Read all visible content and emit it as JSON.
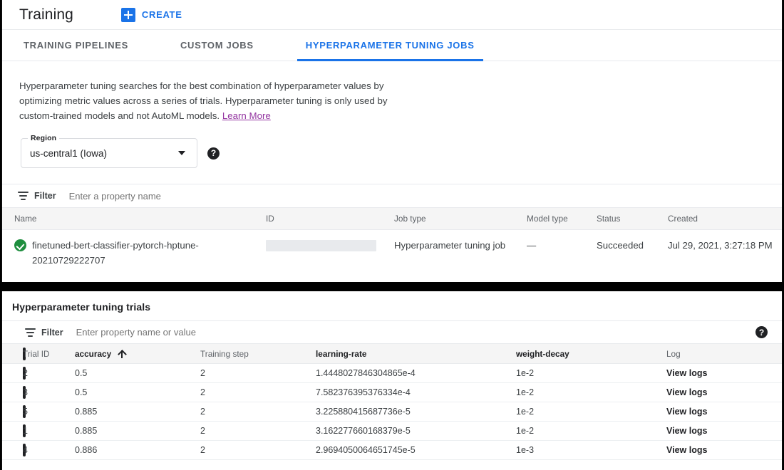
{
  "header": {
    "title": "Training",
    "create_label": "CREATE",
    "create_icon": "plus-icon"
  },
  "tabs": [
    {
      "label": "TRAINING PIPELINES",
      "active": false
    },
    {
      "label": "CUSTOM JOBS",
      "active": false
    },
    {
      "label": "HYPERPARAMETER TUNING JOBS",
      "active": true
    }
  ],
  "description": {
    "text": "Hyperparameter tuning searches for the best combination of hyperparameter values by optimizing metric values across a series of trials. Hyperparameter tuning is only used by custom-trained models and not AutoML models. ",
    "link_label": "Learn More"
  },
  "region": {
    "label": "Region",
    "value": "us-central1 (Iowa)",
    "dropdown_icon": "chevron-down-icon",
    "help_icon": "help-icon"
  },
  "jobs_filter": {
    "label": "Filter",
    "placeholder": "Enter a property name",
    "icon": "filter-icon"
  },
  "jobs_table": {
    "columns": [
      "Name",
      "ID",
      "Job type",
      "Model type",
      "Status",
      "Created"
    ],
    "rows": [
      {
        "status_icon": "success-check-icon",
        "name": "finetuned-bert-classifier-pytorch-hptune-20210729222707",
        "id": "",
        "job_type": "Hyperparameter tuning job",
        "model_type": "—",
        "status": "Succeeded",
        "created": "Jul 29, 2021, 3:27:18 PM"
      }
    ]
  },
  "trials_panel": {
    "title": "Hyperparameter tuning trials",
    "filter": {
      "label": "Filter",
      "placeholder": "Enter property name or value",
      "icon": "filter-icon",
      "help_icon": "help-icon"
    },
    "columns": [
      "Trial ID",
      "accuracy",
      "Training step",
      "learning-rate",
      "weight-decay",
      "Log"
    ],
    "sort": {
      "column": "accuracy",
      "direction": "ascending",
      "icon": "arrow-up-icon"
    },
    "rows": [
      {
        "trial_id": "2",
        "accuracy": "0.5",
        "training_step": "2",
        "learning_rate": "1.4448027846304865e-4",
        "weight_decay": "1e-2",
        "log": "View logs"
      },
      {
        "trial_id": "3",
        "accuracy": "0.5",
        "training_step": "2",
        "learning_rate": "7.582376395376334e-4",
        "weight_decay": "1e-2",
        "log": "View logs"
      },
      {
        "trial_id": "5",
        "accuracy": "0.885",
        "training_step": "2",
        "learning_rate": "3.225880415687736e-5",
        "weight_decay": "1e-2",
        "log": "View logs"
      },
      {
        "trial_id": "1",
        "accuracy": "0.885",
        "training_step": "2",
        "learning_rate": "3.162277660168379e-5",
        "weight_decay": "1e-2",
        "log": "View logs"
      },
      {
        "trial_id": "4",
        "accuracy": "0.886",
        "training_step": "2",
        "learning_rate": "2.9694050064651745e-5",
        "weight_decay": "1e-3",
        "log": "View logs"
      }
    ]
  },
  "colors": {
    "accent": "#1a73e8",
    "link": "#9334a0",
    "success": "#1e8e3e",
    "header_bg": "#f5f5f5"
  }
}
